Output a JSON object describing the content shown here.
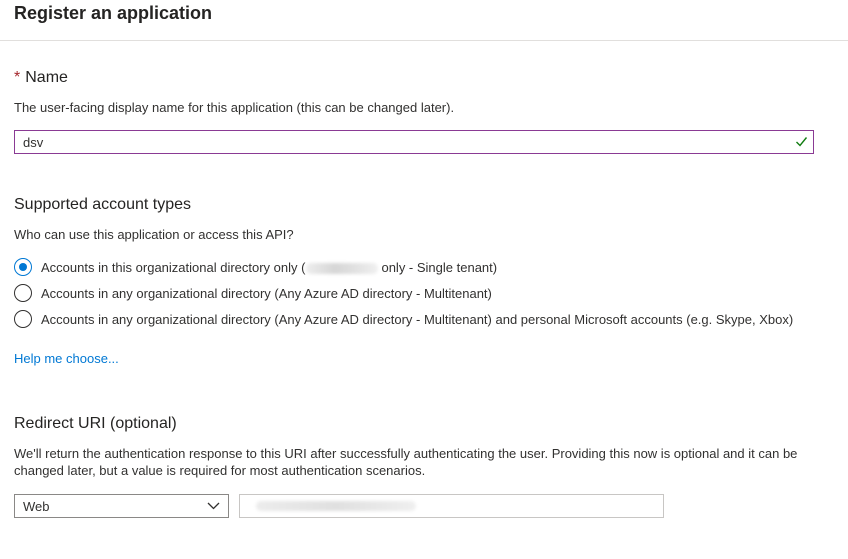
{
  "page": {
    "title": "Register an application"
  },
  "name_section": {
    "required_mark": "*",
    "title": "Name",
    "description": "The user-facing display name for this application (this can be changed later).",
    "value": "dsv",
    "valid_icon": "check-icon",
    "focus_border_color": "#8a3a94"
  },
  "account_types": {
    "title": "Supported account types",
    "question": "Who can use this application or access this API?",
    "options": [
      {
        "label_before": "Accounts in this organizational directory only (",
        "label_after": "only - Single tenant)",
        "checked": true
      },
      {
        "label": "Accounts in any organizational directory (Any Azure AD directory - Multitenant)",
        "checked": false
      },
      {
        "label": "Accounts in any organizational directory (Any Azure AD directory - Multitenant) and personal Microsoft accounts (e.g. Skype, Xbox)",
        "checked": false
      }
    ],
    "help_link": "Help me choose..."
  },
  "redirect_uri": {
    "title": "Redirect URI (optional)",
    "description": "We'll return the authentication response to this URI after successfully authenticating the user. Providing this now is optional and it can be changed later, but a value is required for most authentication scenarios.",
    "platform_selected": "Web",
    "dropdown_icon": "chevron-down-icon"
  },
  "colors": {
    "accent": "#0078d4",
    "required": "#a4262c",
    "valid": "#107c10"
  }
}
